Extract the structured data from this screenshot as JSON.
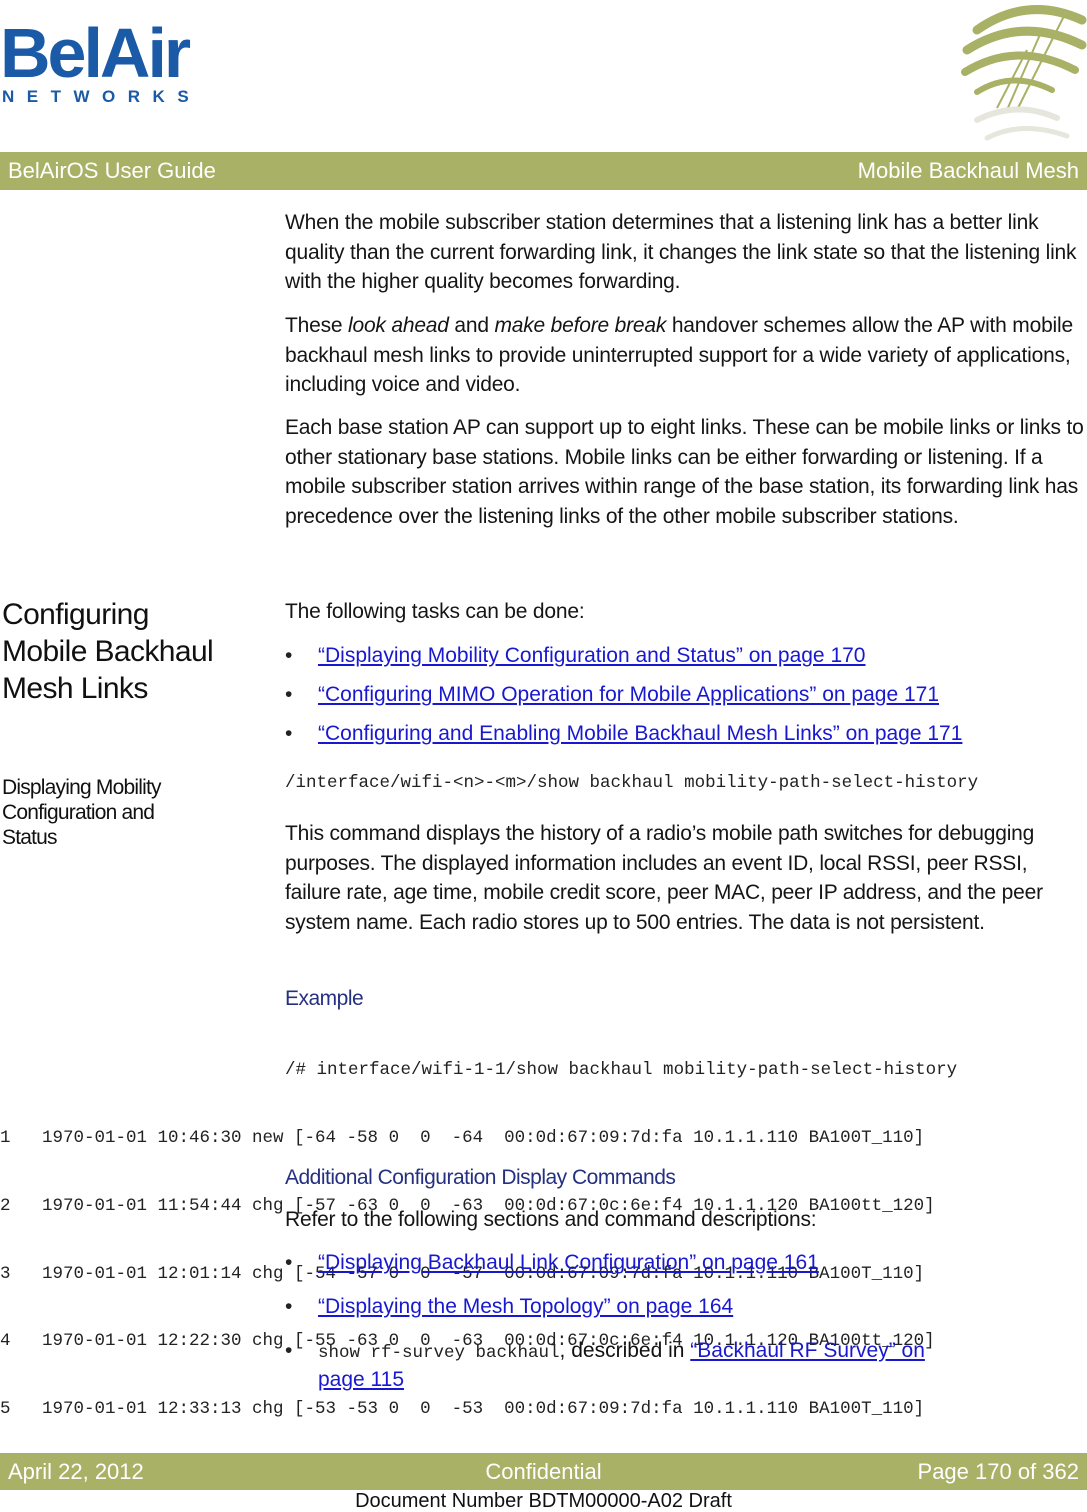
{
  "logo": {
    "word": "BelAir",
    "sub": "NETWORKS",
    "brand_color": "#1b5aa6",
    "accent_color": "#a9b166"
  },
  "header": {
    "left": "BelAirOS User Guide",
    "right": "Mobile Backhaul Mesh"
  },
  "intro": {
    "p1": "When the mobile subscriber station determines that a listening link has a better link quality than the current forwarding link, it changes the link state so that the listening link with the higher quality becomes forwarding.",
    "p2_pre": "These ",
    "p2_em1": "look ahead",
    "p2_mid": " and ",
    "p2_em2": "make before break",
    "p2_post": " handover schemes allow the AP with mobile backhaul mesh links to provide uninterrupted support for a wide variety of applications, including voice and video.",
    "p3": "Each base station AP can support up to eight links. These can be mobile links or links to other stationary base stations. Mobile links can be either forwarding or listening. If a mobile subscriber station arrives within range of the base station, its forwarding link has precedence over the listening links of the other mobile subscriber stations."
  },
  "section": {
    "heading_lines": [
      "Configuring",
      "Mobile Backhaul",
      "Mesh Links"
    ],
    "intro": "The following tasks can be done:",
    "tasks": [
      "“Displaying Mobility Configuration and Status” on page 170",
      "“Configuring MIMO Operation for Mobile Applications” on page 171",
      "“Configuring and Enabling Mobile Backhaul Mesh Links” on page 171"
    ]
  },
  "subsection": {
    "heading_lines": [
      "Displaying Mobility",
      "Configuration and",
      "Status"
    ],
    "command": "/interface/wifi-<n>-<m>/show backhaul mobility-path-select-history",
    "description": "This command displays the history of a radio’s mobile path switches for debugging purposes. The displayed information includes an event ID, local RSSI, peer RSSI, failure rate, age time, mobile credit score, peer MAC, peer IP address, and the peer system name. Each radio stores up to 500 entries. The data is not persistent.",
    "example_label": "Example",
    "example_command": "/# interface/wifi-1-1/show backhaul mobility-path-select-history",
    "example_rows": [
      "1   1970-01-01 10:46:30 new [-64 -58 0  0  -64  00:0d:67:09:7d:fa 10.1.1.110 BA100T_110]",
      "2   1970-01-01 11:54:44 chg [-57 -63 0  0  -63  00:0d:67:0c:6e:f4 10.1.1.120 BA100tt_120]",
      "3   1970-01-01 12:01:14 chg [-54 -57 0  0  -57  00:0d:67:09:7d:fa 10.1.1.110 BA100T_110]",
      "4   1970-01-01 12:22:30 chg [-55 -63 0  0  -63  00:0d:67:0c:6e:f4 10.1.1.120 BA100tt_120]",
      "5   1970-01-01 12:33:13 chg [-53 -53 0  0  -53  00:0d:67:09:7d:fa 10.1.1.110 BA100T_110]"
    ]
  },
  "additional": {
    "heading": "Additional Configuration Display Commands",
    "intro": "Refer to the following sections and command descriptions:",
    "links": [
      "“Displaying Backhaul Link Configuration” on page 161",
      "“Displaying the Mesh Topology” on page 164"
    ],
    "last_command": "show rf-survey backhaul",
    "last_text": ", described in ",
    "last_link_line1": "“Backhaul RF Survey” on ",
    "last_link_line2": "page 115"
  },
  "footer": {
    "date": "April 22, 2012",
    "classification": "Confidential",
    "page": "Page 170 of 362",
    "doc_number": "Document Number BDTM00000-A02 Draft"
  }
}
